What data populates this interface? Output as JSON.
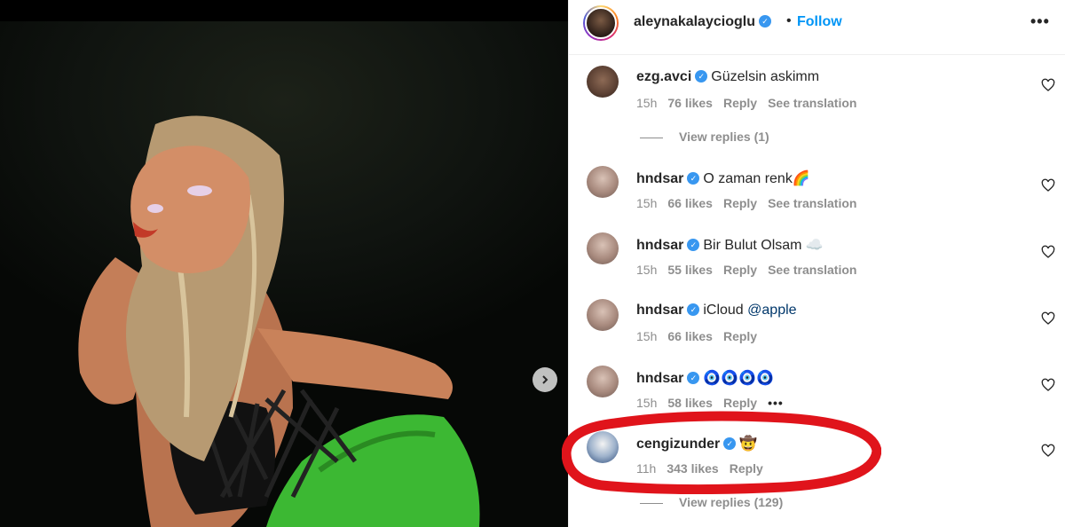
{
  "post": {
    "username": "aleynakalaycioglu",
    "separator": "•",
    "follow_label": "Follow",
    "more_label": "•••"
  },
  "comments": [
    {
      "username": "ezg.avci",
      "text": "Güzelsin askimm",
      "mention": "",
      "time": "15h",
      "likes": "76 likes",
      "reply": "Reply",
      "translate": "See translation"
    },
    {
      "username": "hndsar",
      "text": "O zaman renk🌈",
      "mention": "",
      "time": "15h",
      "likes": "66 likes",
      "reply": "Reply",
      "translate": "See translation"
    },
    {
      "username": "hndsar",
      "text": "Bir Bulut Olsam ☁️",
      "mention": "",
      "time": "15h",
      "likes": "55 likes",
      "reply": "Reply",
      "translate": "See translation"
    },
    {
      "username": "hndsar",
      "text": "iCloud",
      "mention": "@apple",
      "time": "15h",
      "likes": "66 likes",
      "reply": "Reply",
      "translate": ""
    },
    {
      "username": "hndsar",
      "text": "🧿🧿🧿🧿",
      "mention": "",
      "time": "15h",
      "likes": "58 likes",
      "reply": "Reply",
      "translate": "",
      "more": "•••"
    },
    {
      "username": "cengizunder",
      "text": "🤠",
      "mention": "",
      "time": "11h",
      "likes": "343 likes",
      "reply": "Reply",
      "translate": ""
    }
  ],
  "view_replies": [
    {
      "label": "View replies (1)"
    },
    {
      "label": "View replies (129)"
    }
  ],
  "colors": {
    "link_blue": "#0095f6",
    "verified_blue": "#3897f0",
    "meta_gray": "#8e8e8e",
    "annotation_red": "#e0141b",
    "dress_green": "#3cb833"
  },
  "icons": {
    "verified": "verified-badge-icon",
    "heart": "heart-outline-icon",
    "next": "chevron-right-icon",
    "more": "more-horizontal-icon"
  }
}
